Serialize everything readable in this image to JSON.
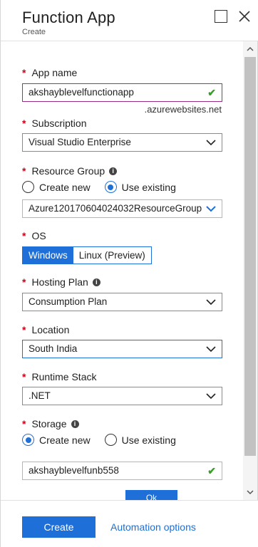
{
  "header": {
    "title": "Function App",
    "subtitle": "Create"
  },
  "form": {
    "app_name": {
      "label": "App name",
      "value": "akshayblevelfunctionapp",
      "suffix": ".azurewebsites.net"
    },
    "subscription": {
      "label": "Subscription",
      "value": "Visual Studio Enterprise"
    },
    "resource_group": {
      "label": "Resource Group",
      "options": [
        "Create new",
        "Use existing"
      ],
      "selected": "Use existing",
      "value": "Azure120170604024032ResourceGroup"
    },
    "os": {
      "label": "OS",
      "options": [
        "Windows",
        "Linux (Preview)"
      ],
      "selected": "Windows"
    },
    "hosting_plan": {
      "label": "Hosting Plan",
      "value": "Consumption Plan"
    },
    "location": {
      "label": "Location",
      "value": "South India"
    },
    "runtime_stack": {
      "label": "Runtime Stack",
      "value": ".NET"
    },
    "storage": {
      "label": "Storage",
      "options": [
        "Create new",
        "Use existing"
      ],
      "selected": "Create new",
      "value": "akshayblevelfunb558"
    },
    "ok_peek_label": "Ok"
  },
  "footer": {
    "create_label": "Create",
    "automation_label": "Automation options"
  },
  "colors": {
    "accent": "#1e6fd8",
    "required": "#d0021b",
    "valid": "#3a9c2a",
    "active_border": "#9b2c8a"
  }
}
